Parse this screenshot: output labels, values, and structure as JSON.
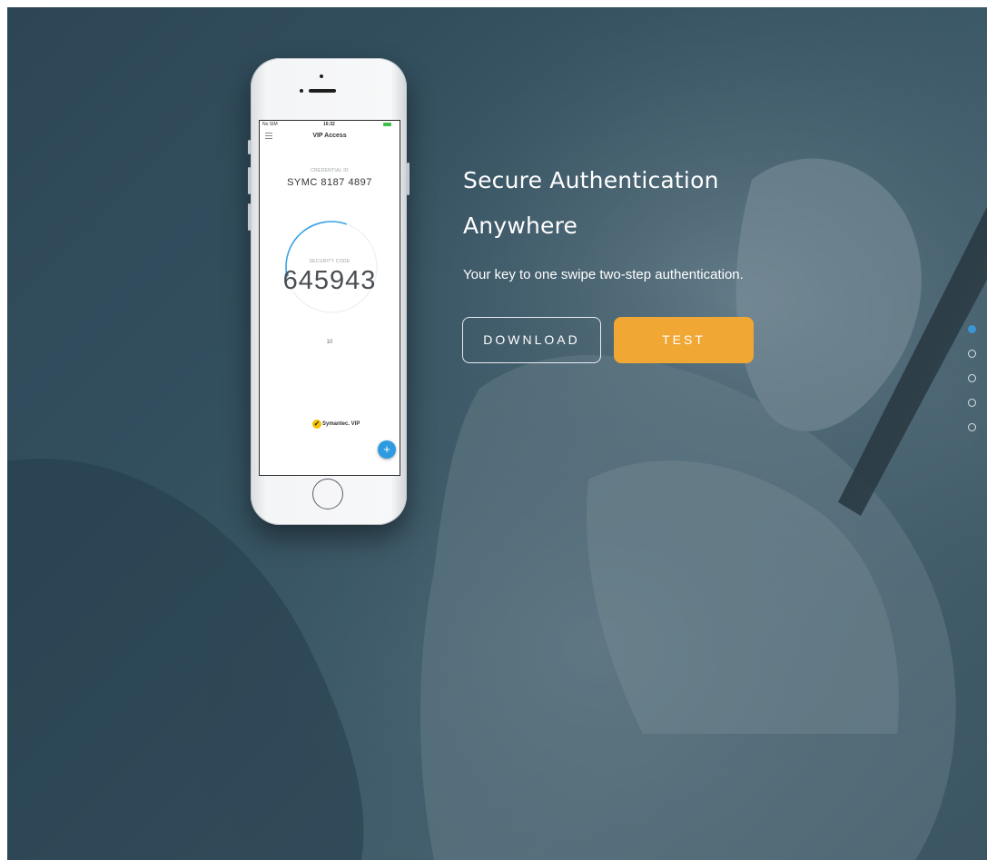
{
  "hero": {
    "title_line1": "Secure Authentication",
    "title_line2": "Anywhere",
    "subtitle": "Your key to one swipe two-step authentication.",
    "download_label": "DOWNLOAD",
    "test_label": "TEST"
  },
  "phone": {
    "status": {
      "carrier": "No SIM",
      "time": "16:32"
    },
    "app_title": "VIP Access",
    "credential_label": "CREDENTIAL ID",
    "credential_id": "SYMC 8187 4897",
    "security_label": "SECURITY CODE",
    "security_code": "645943",
    "timer": "10",
    "timer_fraction": 0.33,
    "brand": "Symantec. VIP",
    "fab_symbol": "+"
  },
  "pager": {
    "count": 5,
    "active_index": 0
  },
  "colors": {
    "accent_orange": "#f0a733",
    "accent_blue": "#3b97d3",
    "background": "#34505f"
  }
}
